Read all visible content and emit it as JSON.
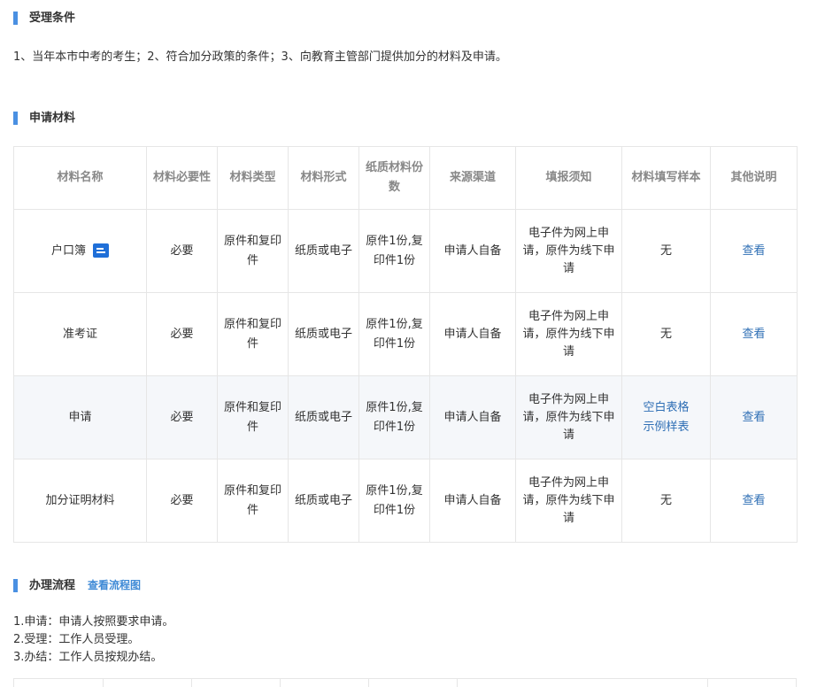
{
  "conditions": {
    "title": "受理条件",
    "text": "1、当年本市中考的考生；2、符合加分政策的条件；3、向教育主管部门提供加分的材料及申请。"
  },
  "materials": {
    "title": "申请材料",
    "headers": [
      "材料名称",
      "材料必要性",
      "材料类型",
      "材料形式",
      "纸质材料份数",
      "来源渠道",
      "填报须知",
      "材料填写样本",
      "其他说明"
    ],
    "rows": [
      {
        "name": "户口簿",
        "required": "必要",
        "type": "原件和复印件",
        "form": "纸质或电子",
        "copies": "原件1份,复印件1份",
        "source": "申请人自备",
        "notice": "电子件为网上申请，原件为线下申请",
        "sample": "无",
        "other": "查看"
      },
      {
        "name": "准考证",
        "required": "必要",
        "type": "原件和复印件",
        "form": "纸质或电子",
        "copies": "原件1份,复印件1份",
        "source": "申请人自备",
        "notice": "电子件为网上申请，原件为线下申请",
        "sample": "无",
        "other": "查看"
      },
      {
        "name": "申请",
        "required": "必要",
        "type": "原件和复印件",
        "form": "纸质或电子",
        "copies": "原件1份,复印件1份",
        "source": "申请人自备",
        "notice": "电子件为网上申请，原件为线下申请",
        "sample_links": [
          "空白表格",
          "示例样表"
        ],
        "other": "查看"
      },
      {
        "name": "加分证明材料",
        "required": "必要",
        "type": "原件和复印件",
        "form": "纸质或电子",
        "copies": "原件1份,复印件1份",
        "source": "申请人自备",
        "notice": "电子件为网上申请，原件为线下申请",
        "sample": "无",
        "other": "查看"
      }
    ]
  },
  "process": {
    "title": "办理流程",
    "link": "查看流程图",
    "steps": [
      "1.申请：申请人按照要求申请。",
      "2.受理：工作人员受理。",
      "3.办结：工作人员按规办结。"
    ]
  },
  "icons": {
    "doc": "document-icon"
  },
  "colors": {
    "accent": "#4a90e2",
    "link": "#2f6fb5"
  }
}
